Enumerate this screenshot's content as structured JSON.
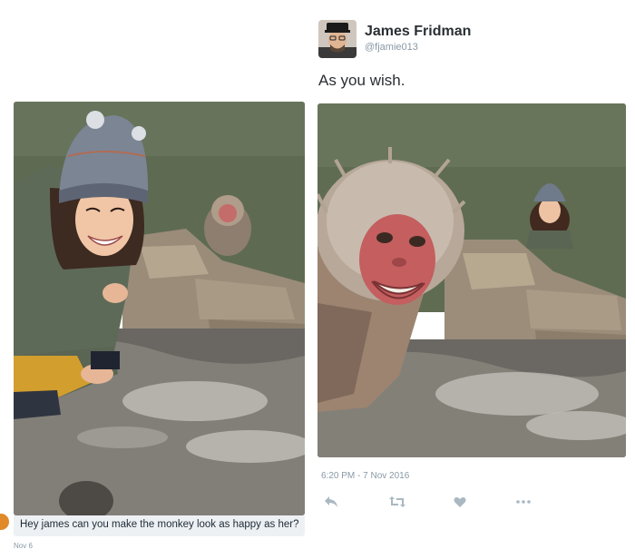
{
  "tweet": {
    "display_name": "James Fridman",
    "handle": "@fjamie013",
    "text": "As you wish.",
    "timestamp": "6:20 PM - 7 Nov 2016"
  },
  "original_post": {
    "comment": "Hey james can you make the monkey look as happy as her?",
    "date": "Nov 6"
  },
  "actions": {
    "reply_icon": "reply-icon",
    "retweet_icon": "retweet-icon",
    "like_icon": "heart-icon",
    "more_icon": "more-dots-icon"
  },
  "colors": {
    "text_primary": "#292f33",
    "text_secondary": "#8899a6",
    "comment_bar": "#eef1f4"
  }
}
